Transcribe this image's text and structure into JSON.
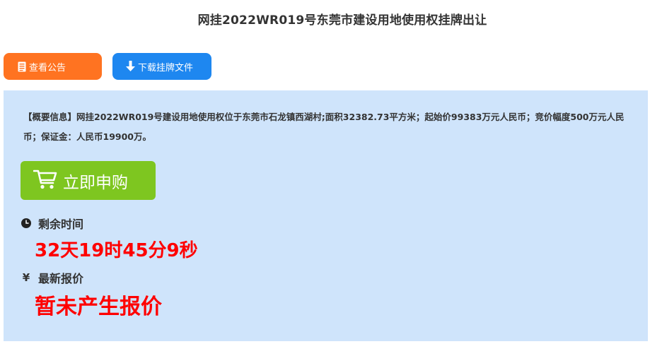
{
  "page": {
    "title": "网挂2022WR019号东莞市建设用地使用权挂牌出让"
  },
  "actions": {
    "notice_label": "查看公告",
    "download_label": "下载挂牌文件"
  },
  "summary": {
    "text": "【概要信息】网挂2022WR019号建设用地使用权位于东莞市石龙镇西湖村;面积32382.73平方米；起始价99383万元人民币；竞价幅度500万元人民币；保证金：人民币19900万。"
  },
  "buy": {
    "label": "立即申购"
  },
  "countdown": {
    "label": "剩余时间",
    "value": "32天19时45分9秒"
  },
  "price": {
    "currency_symbol": "¥",
    "label": "最新报价",
    "value": "暂未产生报价"
  },
  "colors": {
    "notice_button": "#ff7321",
    "download_button": "#1e87f0",
    "panel_background": "#cfe4fb",
    "buy_button": "#7ec620",
    "highlight_red": "#ff0000"
  },
  "icons": {
    "notice": "document-icon",
    "download": "download-arrow-icon",
    "buy": "shopping-cart-icon",
    "time": "clock-icon",
    "price": "yen-icon"
  }
}
